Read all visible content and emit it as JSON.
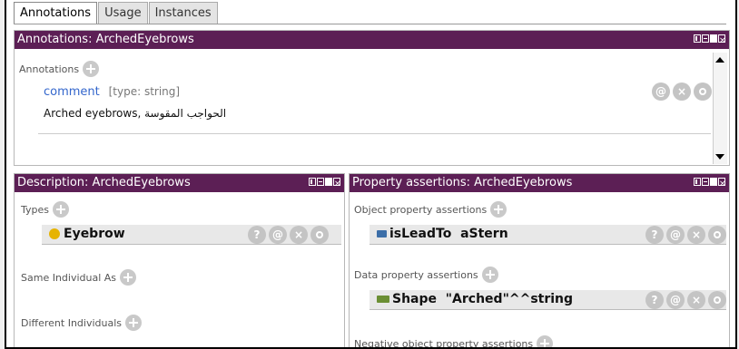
{
  "tabs": [
    {
      "label": "Annotations"
    },
    {
      "label": "Usage"
    },
    {
      "label": "Instances"
    }
  ],
  "annotations_panel": {
    "title": "Annotations: ArchedEyebrows",
    "section": "Annotations",
    "prop": "comment",
    "type_hint": "[type: string]",
    "value": "Arched eyebrows, الحواجب المقوسة",
    "buttons": [
      "@",
      "×",
      "o"
    ]
  },
  "description_panel": {
    "title": "Description: ArchedEyebrows",
    "types_label": "Types",
    "type_entry": "Eyebrow",
    "same_label": "Same Individual As",
    "different_label": "Different Individuals",
    "buttons": [
      "?",
      "@",
      "×",
      "o"
    ]
  },
  "property_panel": {
    "title": "Property assertions: ArchedEyebrows",
    "object_label": "Object property assertions",
    "object_entry": "isLeadTo  aStern",
    "data_label": "Data property assertions",
    "data_entry": "Shape  \"Arched\"^^string",
    "negative_label": "Negative object property assertions",
    "buttons": [
      "?",
      "@",
      "×",
      "o"
    ]
  },
  "colors": {
    "title_bar": "#5c1f55",
    "class_dot": "#e6b300",
    "object_prop": "#3c6ea8",
    "data_prop": "#6b8f34",
    "prop_link": "#3366cc"
  }
}
